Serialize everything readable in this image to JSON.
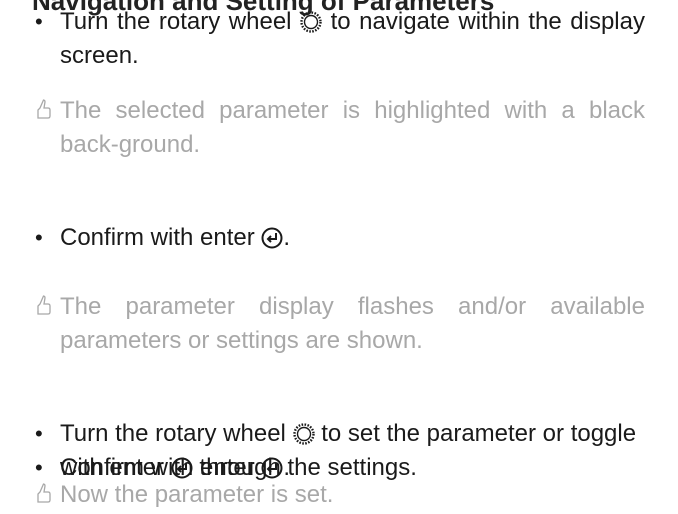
{
  "icons": {
    "rotary": "rotary-wheel-icon",
    "enter": "enter-icon",
    "result": "thumbs-up-icon",
    "color_text": "#1a1a1a",
    "color_result": "#a8a8a8"
  },
  "heading_partial": "Navigation and Setting of Parameters",
  "step1": {
    "bullet": "•",
    "before": "Turn the rotary wheel",
    "after": "to navigate within the display screen."
  },
  "result1": "The selected parameter is highlighted with a black back-ground.",
  "step2": {
    "bullet": "•",
    "before": "Confirm with enter",
    "after": "."
  },
  "result2": "The parameter display flashes and/or available parameters or settings are shown.",
  "step3": {
    "bullet": "•",
    "before": "Turn the rotary wheel",
    "middle": "to set the parameter or toggle with enter",
    "after": "through the settings."
  },
  "step4": {
    "bullet": "•",
    "before": "Confirm with enter",
    "after": "."
  },
  "result3": "Now the parameter is set."
}
